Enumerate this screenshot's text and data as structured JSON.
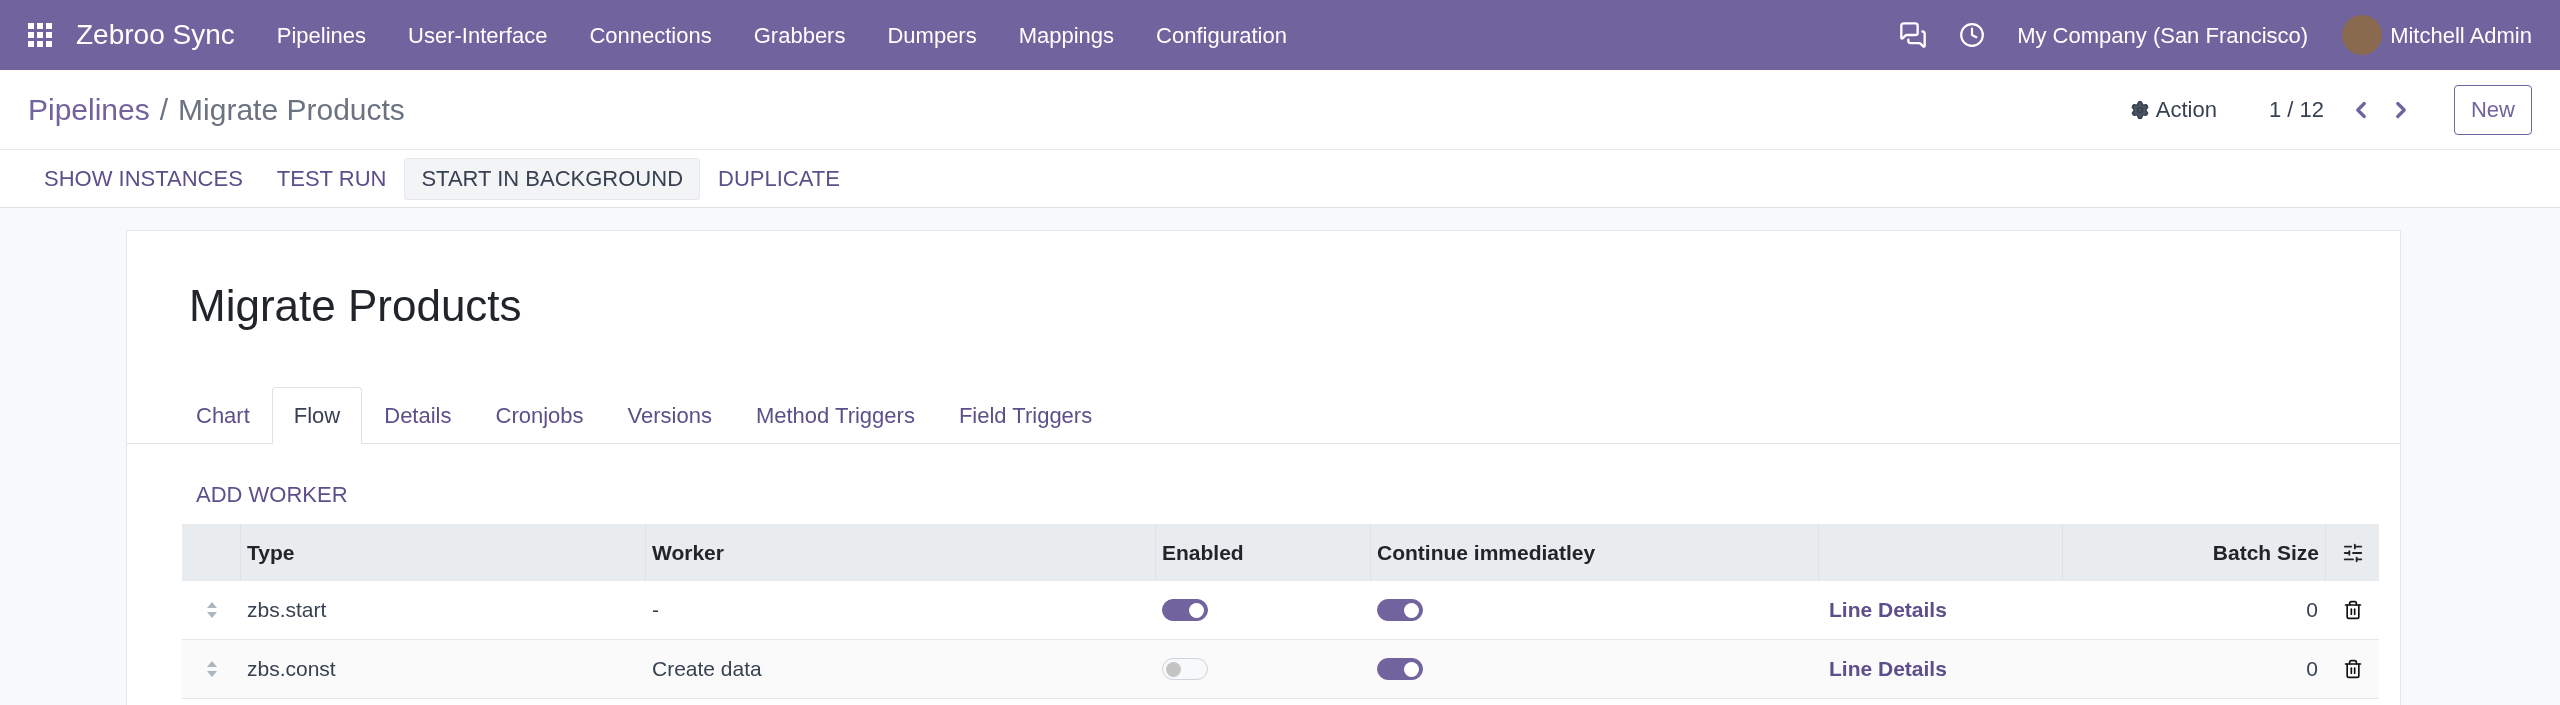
{
  "navbar": {
    "app_name": "Zebroo Sync",
    "menu": [
      "Pipelines",
      "User-Interface",
      "Connections",
      "Grabbers",
      "Dumpers",
      "Mappings",
      "Configuration"
    ],
    "company": "My Company (San Francisco)",
    "user": "Mitchell Admin"
  },
  "breadcrumb": {
    "parent": "Pipelines",
    "separator": "/",
    "current": "Migrate Products"
  },
  "control_panel": {
    "action": "Action",
    "pager": "1 / 12",
    "new_button": "New"
  },
  "header_buttons": [
    {
      "label": "SHOW INSTANCES",
      "highlighted": false
    },
    {
      "label": "TEST RUN",
      "highlighted": false
    },
    {
      "label": "START IN BACKGROUND",
      "highlighted": true
    },
    {
      "label": "DUPLICATE",
      "highlighted": false
    }
  ],
  "form": {
    "title": "Migrate Products",
    "tabs": [
      {
        "label": "Chart",
        "selected": false
      },
      {
        "label": "Flow",
        "selected": true
      },
      {
        "label": "Details",
        "selected": false
      },
      {
        "label": "Cronjobs",
        "selected": false
      },
      {
        "label": "Versions",
        "selected": false
      },
      {
        "label": "Method Triggers",
        "selected": false
      },
      {
        "label": "Field Triggers",
        "selected": false
      }
    ],
    "add_worker": "ADD WORKER",
    "table": {
      "columns": [
        "Type",
        "Worker",
        "Enabled",
        "Continue immediatley",
        "Batch Size"
      ],
      "rows": [
        {
          "type": "zbs.start",
          "worker": "-",
          "enabled": true,
          "continue_immediately": true,
          "link": "Line Details",
          "batch_size": "0"
        },
        {
          "type": "zbs.const",
          "worker": "Create data",
          "enabled": false,
          "continue_immediately": true,
          "link": "Line Details",
          "batch_size": "0"
        }
      ]
    }
  }
}
